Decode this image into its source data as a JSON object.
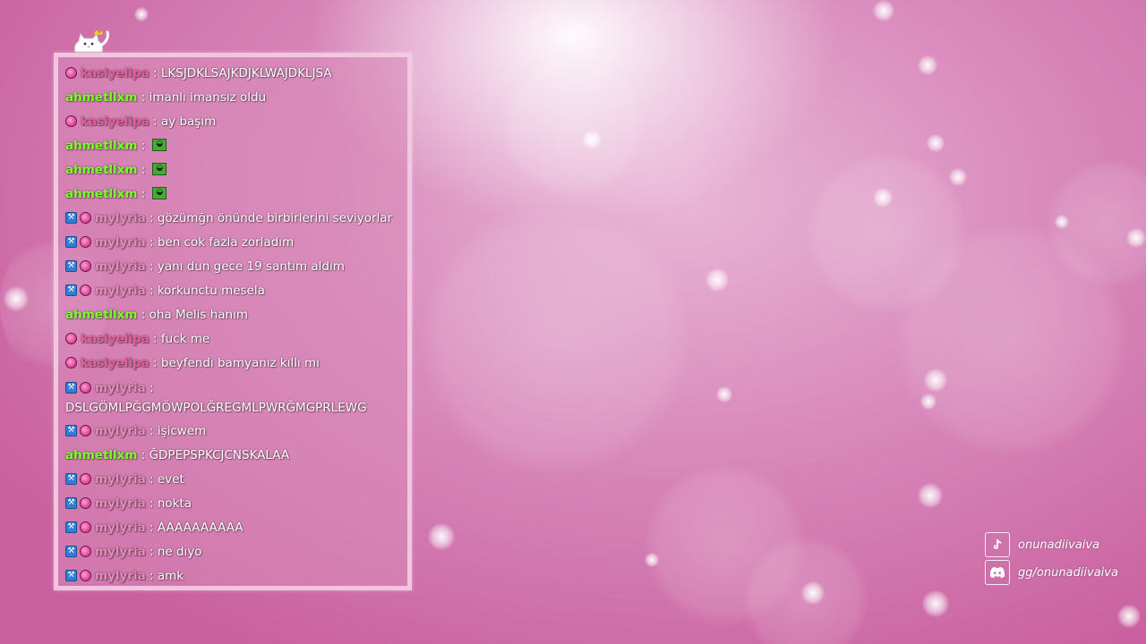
{
  "chat": {
    "messages": [
      {
        "badges": [
          "heart"
        ],
        "user": "kasiyelipa",
        "text": ": LKSJDKLSAJKDJKLWAJDKLJSA"
      },
      {
        "badges": [],
        "user": "ahmetllxm",
        "text": ": imanlı imansız oldu"
      },
      {
        "badges": [
          "heart"
        ],
        "user": "kasiyelipa",
        "text": ": ay başım"
      },
      {
        "badges": [],
        "user": "ahmetllxm",
        "text": ":",
        "emote": "green-emote"
      },
      {
        "badges": [],
        "user": "ahmetllxm",
        "text": ":",
        "emote": "green-emote"
      },
      {
        "badges": [],
        "user": "ahmetllxm",
        "text": ":",
        "emote": "green-emote"
      },
      {
        "badges": [
          "wrench",
          "heart"
        ],
        "user": "mylyria",
        "text": ": gözümğn önünde birbirlerini seviyorlar"
      },
      {
        "badges": [
          "wrench",
          "heart"
        ],
        "user": "mylyria",
        "text": ": ben cok fazla zorladım"
      },
      {
        "badges": [
          "wrench",
          "heart"
        ],
        "user": "mylyria",
        "text": ": yanı dun gece 19 santım aldım"
      },
      {
        "badges": [
          "wrench",
          "heart"
        ],
        "user": "mylyria",
        "text": ": korkunctu mesela"
      },
      {
        "badges": [],
        "user": "ahmetllxm",
        "text": ": oha Melis hanım"
      },
      {
        "badges": [
          "heart"
        ],
        "user": "kasiyelipa",
        "text": ": fuck me"
      },
      {
        "badges": [
          "heart"
        ],
        "user": "kasiyelipa",
        "text": ": beyfendı bamyanız kıllı mı"
      },
      {
        "badges": [
          "wrench",
          "heart"
        ],
        "user": "mylyria",
        "text": ": DSLGÖMLPĞGMÖWPOLĞREGMLPWRĞMGPRLEWG",
        "wrap": true
      },
      {
        "badges": [
          "wrench",
          "heart"
        ],
        "user": "mylyria",
        "text": ": işicwem"
      },
      {
        "badges": [],
        "user": "ahmetllxm",
        "text": ": ĞDPEPSPKCJCNSKALAA"
      },
      {
        "badges": [
          "wrench",
          "heart"
        ],
        "user": "mylyria",
        "text": ": evet"
      },
      {
        "badges": [
          "wrench",
          "heart"
        ],
        "user": "mylyria",
        "text": ": nokta"
      },
      {
        "badges": [
          "wrench",
          "heart"
        ],
        "user": "mylyria",
        "text": ": AAAAAAAAAA"
      },
      {
        "badges": [
          "wrench",
          "heart"
        ],
        "user": "mylyria",
        "text": ": ne dıyo"
      },
      {
        "badges": [
          "wrench",
          "heart"
        ],
        "user": "mylyria",
        "text": ": amk"
      }
    ]
  },
  "socials": {
    "tiktok": {
      "icon": "tiktok-icon",
      "label": "onunadiivaiva"
    },
    "discord": {
      "icon": "discord-icon",
      "label": "gg/onunadiivaiva"
    }
  },
  "colors": {
    "kasiyelipa": "#e45f9c",
    "ahmetllxm": "#7cff2a",
    "mylyria": "#e48cb8",
    "chat_border": "#f4cde4",
    "background": "#d98bbd"
  }
}
